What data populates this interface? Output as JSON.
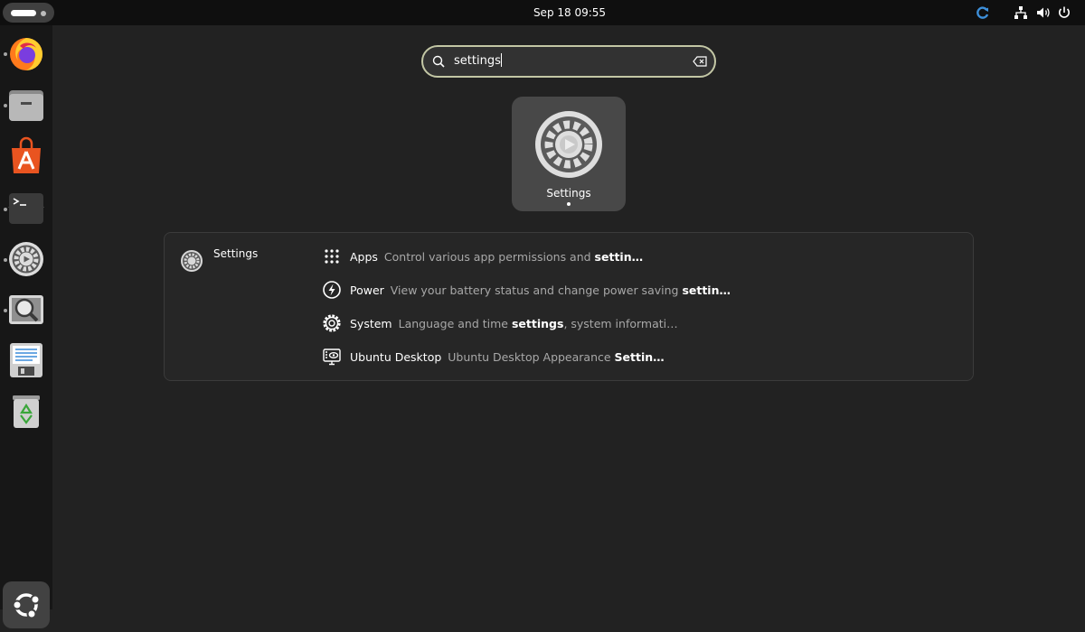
{
  "topbar": {
    "clock": "Sep 18  09:55"
  },
  "dock": {
    "items": [
      {
        "name": "firefox"
      },
      {
        "name": "files"
      },
      {
        "name": "app-center"
      },
      {
        "name": "terminal"
      },
      {
        "name": "settings"
      },
      {
        "name": "image-viewer"
      },
      {
        "name": "text-editor"
      },
      {
        "name": "trash"
      }
    ],
    "show_apps": "show-applications"
  },
  "search": {
    "query": "settings"
  },
  "app_result": {
    "label": "Settings"
  },
  "results": {
    "provider": "Settings",
    "items": [
      {
        "title": "Apps",
        "desc_plain": "Control various app permissions and ",
        "desc_bold": "settin…",
        "icon": "apps-grid-icon"
      },
      {
        "title": "Power",
        "desc_plain": "View your battery status and change power saving ",
        "desc_bold": "settin…",
        "icon": "power-icon"
      },
      {
        "title": "System",
        "desc_plain": "Language and time ",
        "desc_bold": "settings",
        "desc_after": ", system informati…",
        "icon": "system-gear-icon"
      },
      {
        "title": "Ubuntu Desktop",
        "desc_plain": "Ubuntu Desktop Appearance ",
        "desc_bold": "Settin…",
        "icon": "desktop-icon"
      }
    ]
  },
  "colors": {
    "accent": "#c3c7a5",
    "background": "#222222",
    "dock": "#171717",
    "topbar": "#0f0f0f"
  }
}
